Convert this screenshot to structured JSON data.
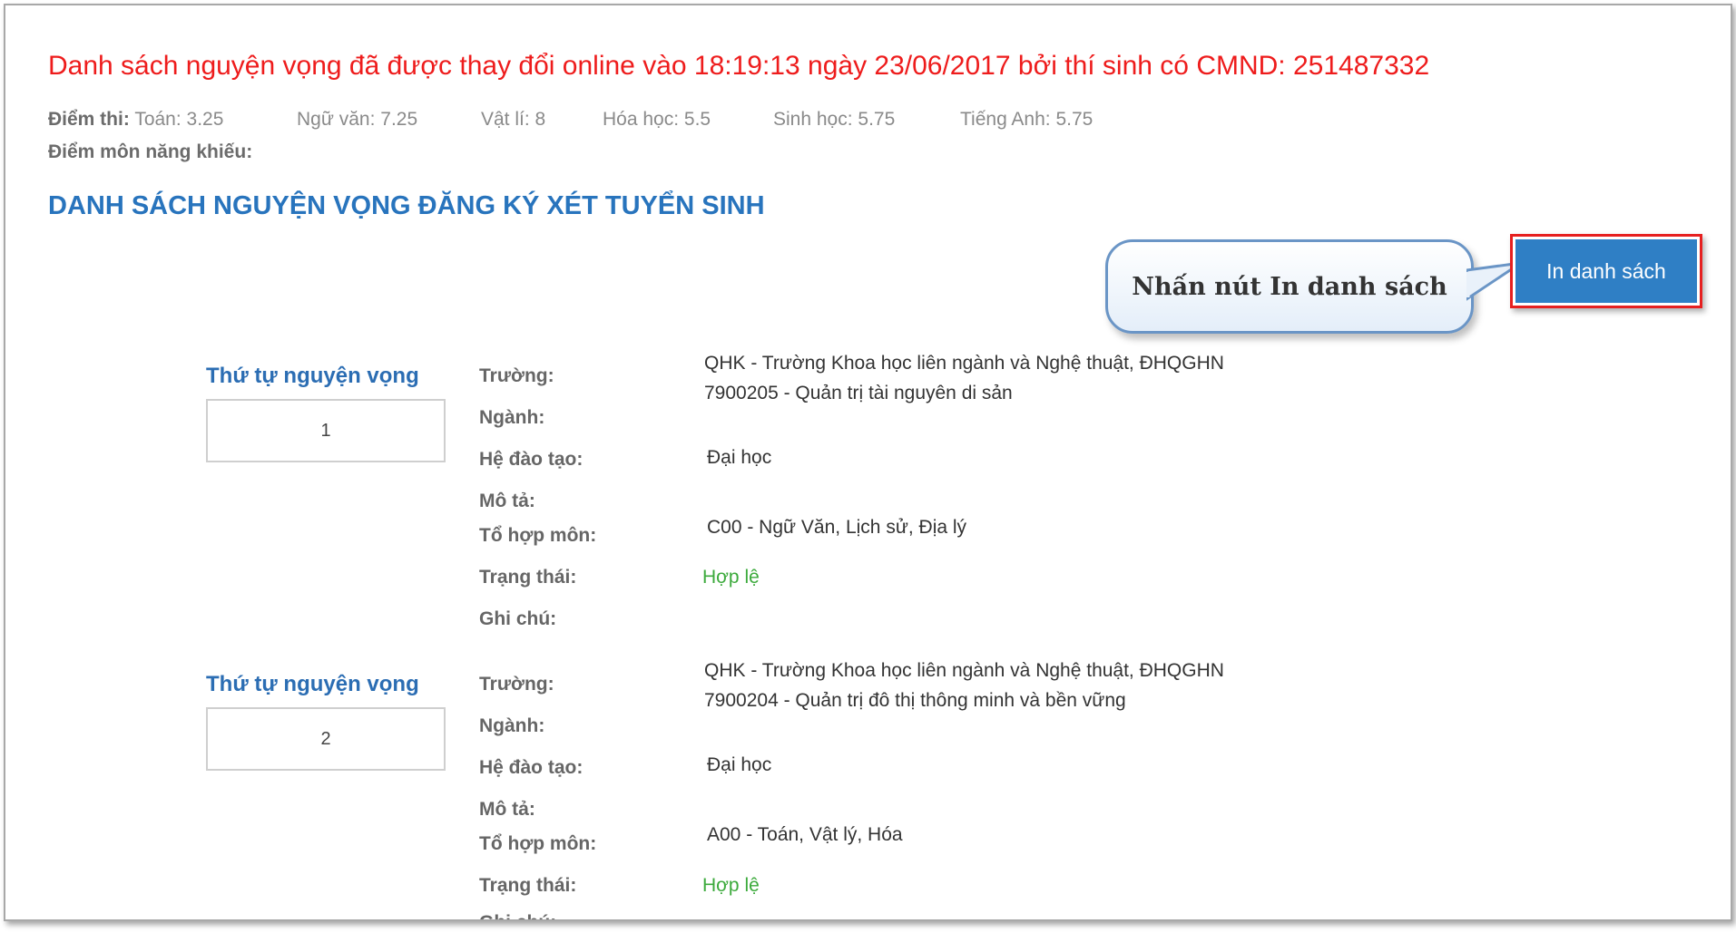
{
  "alert": "Danh sách nguyện vọng đã được thay đổi online vào 18:19:13 ngày 23/06/2017 bởi thí sinh có CMND: 251487332",
  "scores": {
    "prefix": "Điểm thi:",
    "items": [
      "Toán: 3.25",
      "Ngữ văn: 7.25",
      "Vật lí: 8",
      "Hóa học: 5.5",
      "Sinh học: 5.75",
      "Tiếng Anh: 5.75"
    ]
  },
  "talent_label": "Điểm môn năng khiếu:",
  "section_title": "DANH SÁCH NGUYỆN VỌNG ĐĂNG KÝ XÉT TUYỂN SINH",
  "callout_text": "Nhấn nút In danh sách",
  "print_button": "In danh sách",
  "labels": {
    "order": "Thứ tự nguyện vọng",
    "school": "Trường:",
    "major": "Ngành:",
    "training": "Hệ đào tạo:",
    "description": "Mô tả:",
    "combination": "Tổ hợp môn:",
    "status": "Trạng thái:",
    "note": "Ghi chú:"
  },
  "wishes": [
    {
      "order": "1",
      "school": "QHK - Trường Khoa học liên ngành và Nghệ thuật, ĐHQGHN",
      "major": "7900205 - Quản trị tài nguyên di sản",
      "training": "Đại học",
      "combination": "C00 - Ngữ Văn, Lịch sử, Địa lý",
      "status": "Hợp lệ"
    },
    {
      "order": "2",
      "school": "QHK - Trường Khoa học liên ngành và Nghệ thuật, ĐHQGHN",
      "major": "7900204 - Quản trị đô thị thông minh và bền vững",
      "training": "Đại học",
      "combination": "A00 - Toán, Vật lý, Hóa",
      "status": "Hợp lệ"
    }
  ],
  "colors": {
    "alert": "#ee1c1c",
    "title": "#2874bd",
    "button": "#2f7fc5",
    "status_ok": "#3caa3c"
  }
}
